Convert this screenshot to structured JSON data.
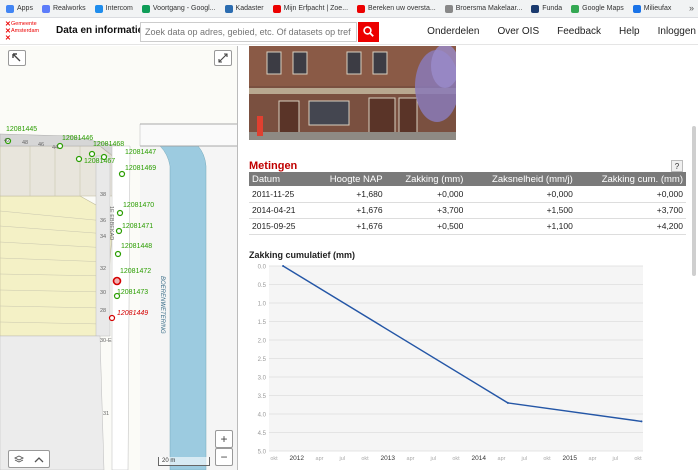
{
  "bookmarks": [
    {
      "label": "Apps",
      "icon": "apps-grid-icon",
      "color": "#4285f4"
    },
    {
      "label": "Realworks",
      "icon": "realworks-icon",
      "color": "#5c7cfa"
    },
    {
      "label": "Intercom",
      "icon": "intercom-icon",
      "color": "#1f8ded"
    },
    {
      "label": "Voortgang - Googl...",
      "icon": "sheets-icon",
      "color": "#0f9d58"
    },
    {
      "label": "Kadaster",
      "icon": "kadaster-icon",
      "color": "#2b6cb0"
    },
    {
      "label": "Mijn Erfpacht | Zoe...",
      "icon": "amsterdam-icon",
      "color": "#ec0000"
    },
    {
      "label": "Bereken uw oversta...",
      "icon": "amsterdam-icon",
      "color": "#ec0000"
    },
    {
      "label": "Broersma Makelaar...",
      "icon": "broersma-icon",
      "color": "#888888"
    },
    {
      "label": "Funda",
      "icon": "funda-icon",
      "color": "#1b3b6f"
    },
    {
      "label": "Google Maps",
      "icon": "google-maps-icon",
      "color": "#34a853"
    },
    {
      "label": "Milieufax",
      "icon": "milieufax-icon",
      "color": "#1a73e8"
    }
  ],
  "bookmarks_more": "»",
  "header": {
    "logo_lines": [
      "Gemeente",
      "Amsterdam"
    ],
    "title": "Data en informatie",
    "search_placeholder": "Zoek data op adres, gebied, etc. Of datasets op tref",
    "nav": [
      "Onderdelen",
      "Over OIS",
      "Feedback",
      "Help",
      "Inloggen"
    ]
  },
  "map": {
    "labels": [
      {
        "id": "12081445",
        "selected": false
      },
      {
        "id": "12081446",
        "selected": false
      },
      {
        "id": "12081468",
        "selected": false
      },
      {
        "id": "12081447",
        "selected": false
      },
      {
        "id": "12081467",
        "selected": false
      },
      {
        "id": "12081469",
        "selected": false
      },
      {
        "id": "12081470",
        "selected": false
      },
      {
        "id": "12081471",
        "selected": false
      },
      {
        "id": "12081448",
        "selected": false
      },
      {
        "id": "12081472",
        "selected": false
      },
      {
        "id": "12081473",
        "selected": false
      },
      {
        "id": "12081449",
        "selected": true
      }
    ],
    "house_numbers": [
      "42",
      "48",
      "46",
      "44",
      "40",
      "38",
      "36",
      "34",
      "32",
      "30",
      "28",
      "30-E",
      "31"
    ],
    "street_labels": [
      "BOERENWETERING",
      "1E EBBEKAD"
    ],
    "scale_label": "20 m",
    "zoom_in": "+",
    "zoom_out": "−"
  },
  "metingen": {
    "title": "Metingen",
    "help": "?",
    "columns": [
      "Datum",
      "Hoogte NAP",
      "Zakking (mm)",
      "Zaksnelheid (mm/j)",
      "Zakking cum. (mm)"
    ],
    "rows": [
      [
        "2011-11-25",
        "+1,680",
        "+0,000",
        "+0,000",
        "+0,000"
      ],
      [
        "2014-04-21",
        "+1,676",
        "+3,700",
        "+1,500",
        "+3,700"
      ],
      [
        "2015-09-25",
        "+1,676",
        "+0,500",
        "+1,100",
        "+4,200"
      ]
    ]
  },
  "chart_title": "Zakking cumulatief (mm)",
  "chart_data": {
    "type": "line",
    "title": "Zakking cumulatief (mm)",
    "x": [
      "2011-11-25",
      "2014-04-21",
      "2015-09-25"
    ],
    "series": [
      {
        "values": [
          0.0,
          3.7,
          4.2
        ]
      }
    ],
    "ylim": [
      0,
      5
    ],
    "y_inverted": true,
    "y_ticks": [
      "0.0",
      "0.5",
      "1.0",
      "1.5",
      "2.0",
      "2.5",
      "3.0",
      "3.5",
      "4.0",
      "4.5",
      "5.0"
    ],
    "x_ticks": [
      "okt",
      "2012",
      "apr",
      "jul",
      "okt",
      "2013",
      "apr",
      "jul",
      "okt",
      "2014",
      "apr",
      "jul",
      "okt",
      "2015",
      "apr",
      "jul",
      "okt"
    ],
    "xlim": [
      "2011-10-01",
      "2015-10-01"
    ],
    "grid": true,
    "line_color": "#2456a6"
  }
}
